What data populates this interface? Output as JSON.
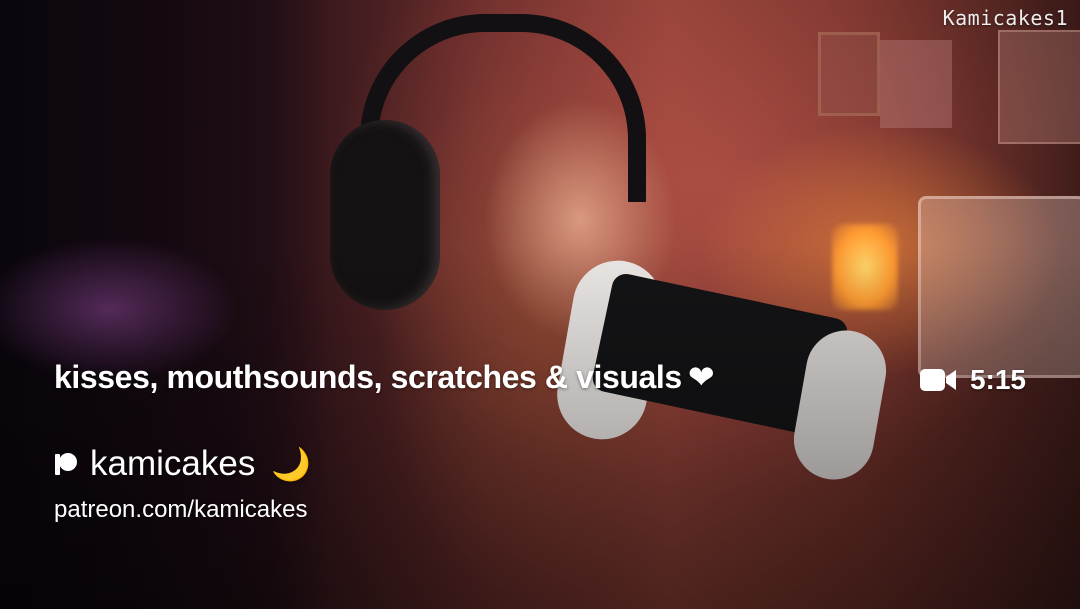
{
  "watermark": "Kamicakes1",
  "video": {
    "title": "kisses, mouthsounds, scratches & visuals",
    "title_emoji": "❤",
    "duration": "5:15",
    "duration_icon": "video-camera-icon"
  },
  "creator": {
    "icon": "patreon-icon",
    "name": "kamicakes",
    "emoji": "🌙",
    "url": "patreon.com/kamicakes"
  },
  "colors": {
    "text": "#ffffff",
    "moon": "#ffcf3d"
  }
}
